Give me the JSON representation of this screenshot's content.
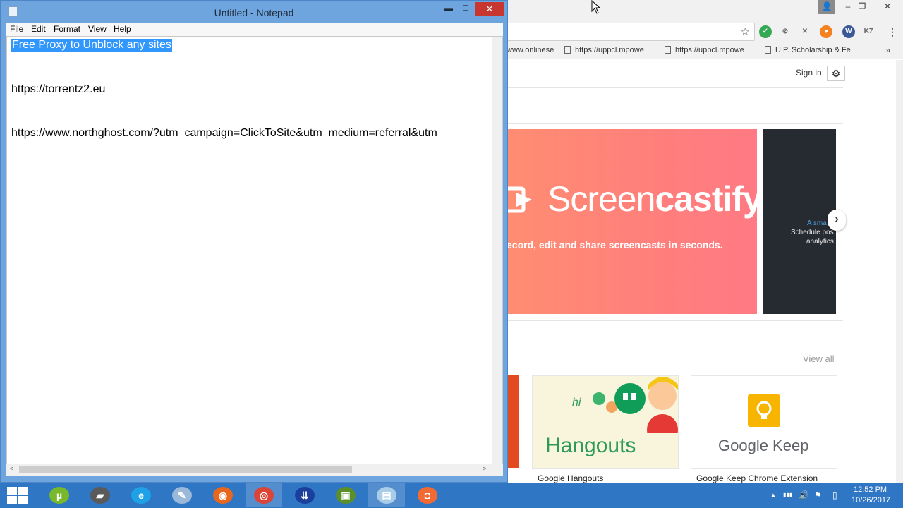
{
  "notepad": {
    "title": "Untitled - Notepad",
    "min_glyph": "▬",
    "max_glyph": "☐",
    "close_glyph": "✕",
    "menu": [
      "File",
      "Edit",
      "Format",
      "View",
      "Help"
    ],
    "lines": [
      "Free Proxy to Unblock any sites",
      "https://torrentz2.eu",
      "https://www.northghost.com/?utm_campaign=ClickToSite&utm_medium=referral&utm_"
    ],
    "scroll_left": "<",
    "scroll_right": ">"
  },
  "chrome": {
    "win_user": "👤",
    "win_min": "–",
    "win_max": "❐",
    "win_close": "✕",
    "star": "☆",
    "extensions": [
      {
        "glyph": "✓",
        "color": "#34a853"
      },
      {
        "glyph": "⊘",
        "color": "#ffffff"
      },
      {
        "glyph": "✕",
        "color": "#ffffff"
      },
      {
        "glyph": "●",
        "color": "#f58220"
      },
      {
        "glyph": "W",
        "color": "#3b5998"
      },
      {
        "glyph": "K7",
        "color": "#ffffff"
      }
    ],
    "menu_dots": "⋮",
    "bookmarks": [
      "www.onlinese",
      "https://uppcl.mpowe",
      "https://uppcl.mpowe",
      "U.P. Scholarship & Fe"
    ],
    "bookmarks_more": "»",
    "signin": "Sign in",
    "gear": "⚙",
    "banner": {
      "logo_light": "Screen",
      "logo_bold": "castify",
      "tagline": "ecord, edit and share screencasts in seconds."
    },
    "banner2": {
      "title": "A sma",
      "line1": "Schedule pos",
      "line2": "analytics"
    },
    "next": "›",
    "view_all": "View all",
    "hangouts_hi": "hi",
    "hangouts_tile": "Hangouts",
    "keep_tile": "Google Keep",
    "caption_hangouts": "Google Hangouts",
    "caption_keep": "Google Keep Chrome Extension"
  },
  "taskbar": {
    "apps": [
      {
        "name": "utorrent",
        "glyph": "µ",
        "color": "#78b82a"
      },
      {
        "name": "scanner",
        "glyph": "▰",
        "color": "#5a5a5a"
      },
      {
        "name": "ie",
        "glyph": "e",
        "color": "#1ea1e6"
      },
      {
        "name": "pen",
        "glyph": "✎",
        "color": "#9ab8d8"
      },
      {
        "name": "firefox",
        "glyph": "◉",
        "color": "#e8671c"
      },
      {
        "name": "chrome",
        "glyph": "◎",
        "color": "#db4437"
      },
      {
        "name": "network",
        "glyph": "⇊",
        "color": "#1a3f9c"
      },
      {
        "name": "android",
        "glyph": "▣",
        "color": "#5b8f2a"
      },
      {
        "name": "notepad",
        "glyph": "▤",
        "color": "#a8cde8"
      },
      {
        "name": "screencastify",
        "glyph": "◘",
        "color": "#f26a33"
      }
    ],
    "tray_up": "▲",
    "tray_signal": "▮▮▮",
    "tray_volume": "🔊",
    "tray_flag": "⚑",
    "tray_battery": "▯",
    "time": "12:52 PM",
    "date": "10/26/2017"
  }
}
